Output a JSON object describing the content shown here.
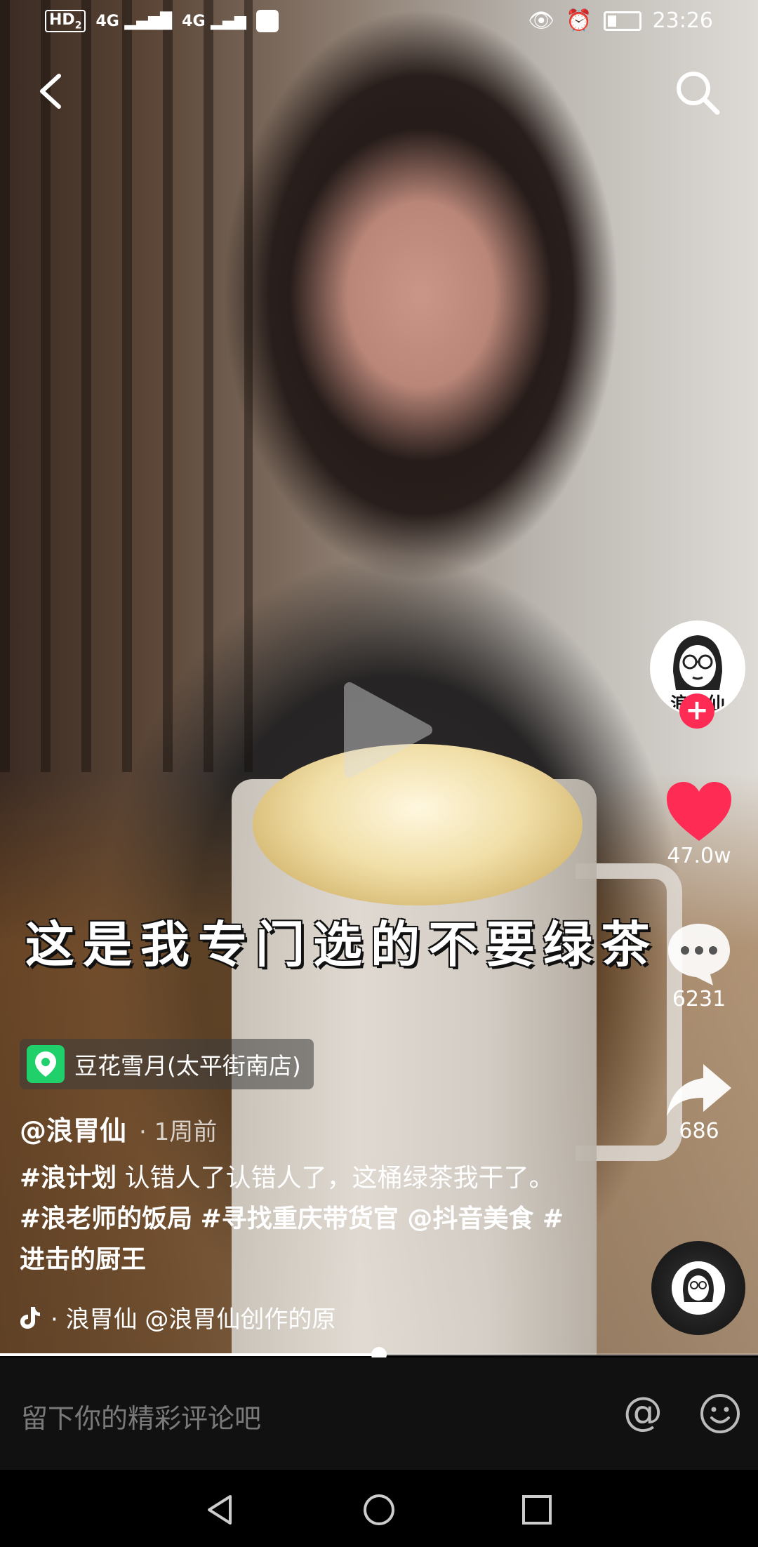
{
  "status_bar": {
    "hd_label": "HD",
    "hd_sub": "2",
    "signal_1": "4G",
    "signal_2": "4G",
    "time": "23:26"
  },
  "video": {
    "subtitle": "这是我专门选的不要绿茶"
  },
  "right_rail": {
    "avatar_label": "浪胃仙",
    "likes": "47.0w",
    "comments": "6231",
    "shares": "686",
    "accent_color": "#fe2c55"
  },
  "location": {
    "name": "豆花雪月(太平街南店)"
  },
  "author": {
    "handle": "@浪胃仙",
    "time_ago": "· 1周前"
  },
  "description": {
    "tag1": "#浪计划",
    "text1": " 认错人了认错人了，这桶绿茶我干了。",
    "tag2": "#浪老师的饭局",
    "tag3": "#寻找重庆带货官",
    "mention": " @抖音美食 ",
    "tag4": "#进击的厨王"
  },
  "music": {
    "text": "· 浪胃仙    @浪胃仙创作的原"
  },
  "progress": {
    "fraction": 0.5
  },
  "comment_bar": {
    "placeholder": "留下你的精彩评论吧",
    "at_label": "@"
  },
  "icons": {
    "back": "back-arrow-icon",
    "search": "search-icon",
    "like": "heart-icon",
    "comment": "comment-bubble-icon",
    "share": "share-arrow-icon",
    "location": "location-pin-icon",
    "music": "tiktok-note-icon",
    "emoji": "emoji-icon",
    "nav_back": "nav-back-icon",
    "nav_home": "nav-home-icon",
    "nav_recents": "nav-recents-icon"
  }
}
